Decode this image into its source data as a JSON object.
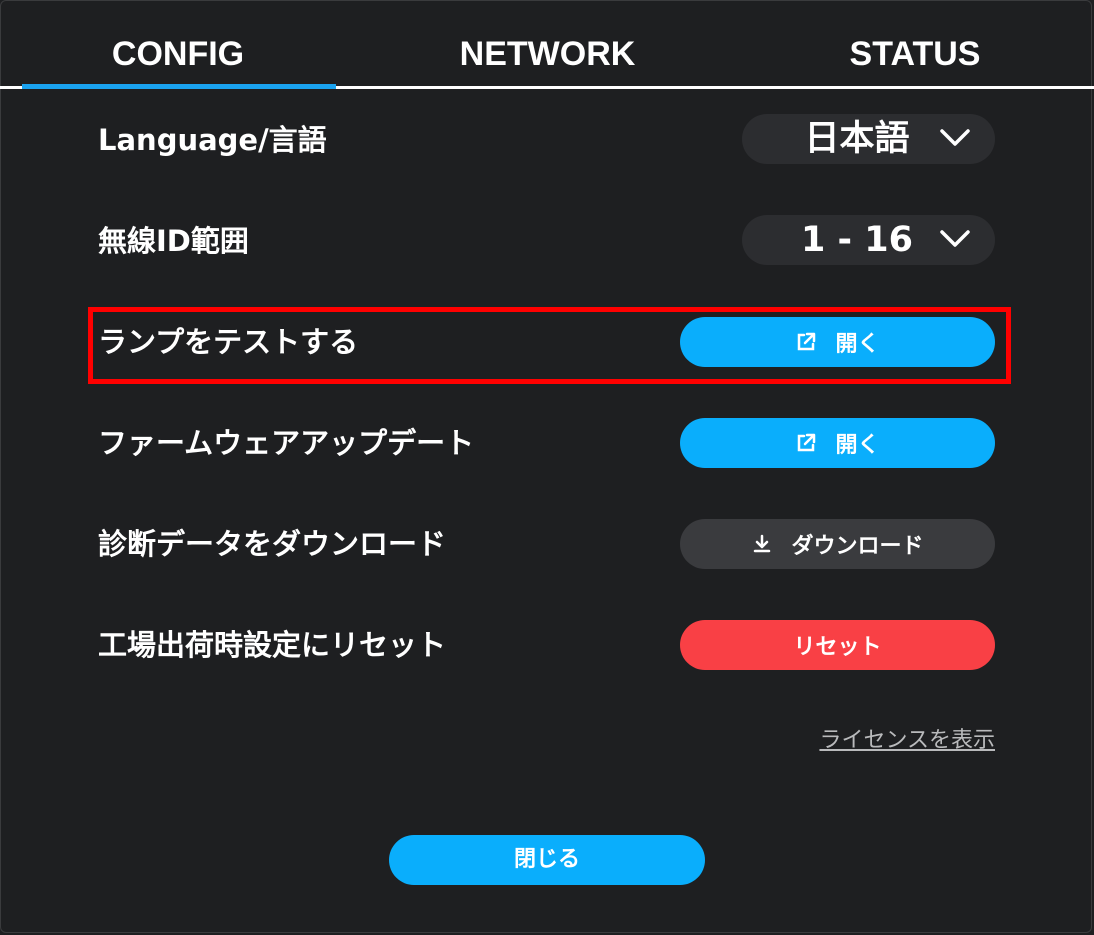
{
  "tabs": [
    {
      "label": "CONFIG",
      "active": true
    },
    {
      "label": "NETWORK",
      "active": false
    },
    {
      "label": "STATUS",
      "active": false
    }
  ],
  "settings": {
    "language": {
      "label": "Language/言語",
      "value": "日本語"
    },
    "wireless_id_range": {
      "label": "無線ID範囲",
      "value": "1 - 16"
    },
    "lamp_test": {
      "label": "ランプをテストする",
      "button": "開く",
      "button_icon": "external-link-icon"
    },
    "firmware_update": {
      "label": "ファームウェアアップデート",
      "button": "開く",
      "button_icon": "external-link-icon"
    },
    "diagnostics": {
      "label": "診断データをダウンロード",
      "button": "ダウンロード",
      "button_icon": "download-icon"
    },
    "factory_reset": {
      "label": "工場出荷時設定にリセット",
      "button": "リセット"
    }
  },
  "license_link": "ライセンスを表示",
  "close_button": "閉じる",
  "colors": {
    "background": "#1e1f21",
    "accent_blue": "#0aaefc",
    "danger_red": "#f94045",
    "pill_dark": "#2c2d30",
    "highlight": "#ff0000"
  }
}
